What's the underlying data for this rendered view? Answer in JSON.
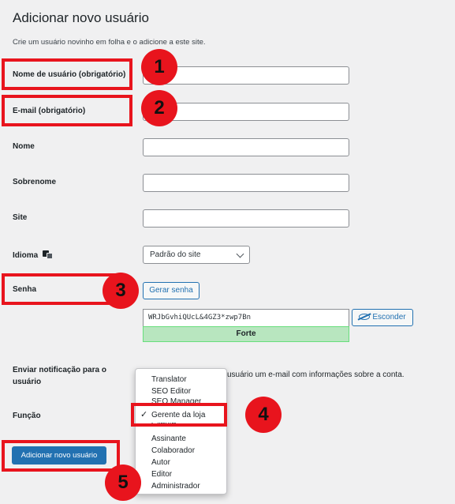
{
  "page": {
    "title": "Adicionar novo usuário",
    "description": "Crie um usuário novinho em folha e o adicione a este site."
  },
  "fields": {
    "username_label": "Nome de usuário (obrigatório)",
    "email_label": "E-mail (obrigatório)",
    "firstname_label": "Nome",
    "lastname_label": "Sobrenome",
    "site_label": "Site",
    "language_label": "Idioma",
    "language_value": "Padrão do site",
    "password_label": "Senha",
    "generate_password": "Gerar senha",
    "password_value": "WRJbGvhiQUcL&4GZ3*zwp7Bn",
    "password_strength": "Forte",
    "hide_button": "Esconder",
    "notify_label": "Enviar notificação para o usuário",
    "notify_text": "usuário um e-mail com informações sobre a conta.",
    "role_label": "Função"
  },
  "role_dropdown": {
    "options": [
      "Translator",
      "SEO Editor",
      "SEO Manager",
      "Gerente da loja",
      "Cliente",
      "Assinante",
      "Colaborador",
      "Autor",
      "Editor",
      "Administrador"
    ],
    "selected": "Gerente da loja"
  },
  "submit_button": "Adicionar novo usuário",
  "markers": [
    "1",
    "2",
    "3",
    "4",
    "5"
  ],
  "colors": {
    "annotation_red": "#e8141d",
    "primary_blue": "#2271b1",
    "strength_green": "#b8e6bf"
  }
}
